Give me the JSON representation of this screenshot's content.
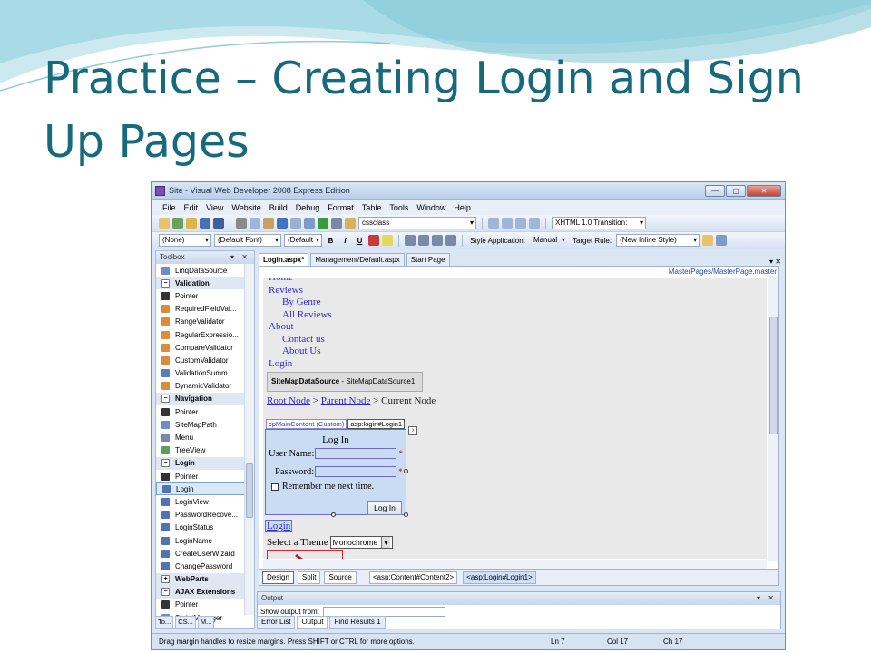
{
  "slide": {
    "title": "Practice – Creating Login and Sign Up Pages"
  },
  "window": {
    "title": "Site - Visual Web Developer 2008 Express Edition",
    "buttons": {
      "minimize": "—",
      "maximize": "▢",
      "close": "✕"
    }
  },
  "menu": [
    "File",
    "Edit",
    "View",
    "Website",
    "Build",
    "Debug",
    "Format",
    "Table",
    "Tools",
    "Window",
    "Help"
  ],
  "toolbar1": {
    "css_combo": "cssclass",
    "doctype_combo": "XHTML 1.0 Transition:"
  },
  "toolbar2": {
    "block_format": "(None)",
    "font": "(Default Font)",
    "size": "(Default",
    "bold": "B",
    "italic": "I",
    "underline": "U",
    "style_application_label": "Style Application:",
    "style_application_value": "Manual",
    "target_rule_label": "Target Rule:",
    "target_rule_value": "(New Inline Style)"
  },
  "toolbox": {
    "title": "Toolbox",
    "controls": "▾ ✕",
    "items": [
      {
        "label": "LinqDataSource",
        "kind": "item",
        "icon": "datasource-icon"
      },
      {
        "label": "Validation",
        "kind": "cat",
        "icon": "collapse-icon"
      },
      {
        "label": "Pointer",
        "kind": "item",
        "icon": "pointer-icon"
      },
      {
        "label": "RequiredFieldVal...",
        "kind": "item",
        "icon": "validator-icon"
      },
      {
        "label": "RangeValidator",
        "kind": "item",
        "icon": "validator-icon"
      },
      {
        "label": "RegularExpressio...",
        "kind": "item",
        "icon": "validator-icon"
      },
      {
        "label": "CompareValidator",
        "kind": "item",
        "icon": "validator-icon"
      },
      {
        "label": "CustomValidator",
        "kind": "item",
        "icon": "validator-icon"
      },
      {
        "label": "ValidationSumm...",
        "kind": "item",
        "icon": "summary-icon"
      },
      {
        "label": "DynamicValidator",
        "kind": "item",
        "icon": "validator-icon"
      },
      {
        "label": "Navigation",
        "kind": "cat",
        "icon": "collapse-icon"
      },
      {
        "label": "Pointer",
        "kind": "item",
        "icon": "pointer-icon"
      },
      {
        "label": "SiteMapPath",
        "kind": "item",
        "icon": "sitemap-icon"
      },
      {
        "label": "Menu",
        "kind": "item",
        "icon": "menu-icon"
      },
      {
        "label": "TreeView",
        "kind": "item",
        "icon": "treeview-icon"
      },
      {
        "label": "Login",
        "kind": "cat",
        "icon": "collapse-icon"
      },
      {
        "label": "Pointer",
        "kind": "item",
        "icon": "pointer-icon"
      },
      {
        "label": "Login",
        "kind": "sel",
        "icon": "login-icon"
      },
      {
        "label": "LoginView",
        "kind": "item",
        "icon": "loginview-icon"
      },
      {
        "label": "PasswordRecove...",
        "kind": "item",
        "icon": "password-icon"
      },
      {
        "label": "LoginStatus",
        "kind": "item",
        "icon": "loginstatus-icon"
      },
      {
        "label": "LoginName",
        "kind": "item",
        "icon": "loginname-icon"
      },
      {
        "label": "CreateUserWizard",
        "kind": "item",
        "icon": "wizard-icon"
      },
      {
        "label": "ChangePassword",
        "kind": "item",
        "icon": "password-icon"
      },
      {
        "label": "WebParts",
        "kind": "cat",
        "icon": "expand-icon"
      },
      {
        "label": "AJAX Extensions",
        "kind": "cat",
        "icon": "collapse-icon"
      },
      {
        "label": "Pointer",
        "kind": "item",
        "icon": "pointer-icon"
      },
      {
        "label": "ScriptManager",
        "kind": "item",
        "icon": "script-icon"
      }
    ],
    "bottom_tabs": [
      "To...",
      "CS...",
      "M..."
    ]
  },
  "doc_tabs": [
    "Login.aspx*",
    "Management/Default.aspx",
    "Start Page"
  ],
  "doc_tab_controls": "▾ ✕",
  "design": {
    "master_path": "MasterPages/MasterPage.master",
    "nav": [
      {
        "label": "Home",
        "sub": false
      },
      {
        "label": "Reviews",
        "sub": false
      },
      {
        "label": "By Genre",
        "sub": true
      },
      {
        "label": "All Reviews",
        "sub": true
      },
      {
        "label": "About",
        "sub": false
      },
      {
        "label": "Contact us",
        "sub": true
      },
      {
        "label": "About Us",
        "sub": true
      },
      {
        "label": "Login",
        "sub": false
      }
    ],
    "sitemap_datasource_type": "SiteMapDataSource",
    "sitemap_datasource_id": " - SiteMapDataSource1",
    "breadcrumb": {
      "root": "Root Node",
      "sep": " > ",
      "parent": "Parent Node",
      "current": "Current Node"
    },
    "content_tag": "cpMainContent (Custom)",
    "login_tag": "asp:login#Login1",
    "login": {
      "title": "Log In",
      "username_label": "User Name:",
      "password_label": "Password:",
      "required_marker": "*",
      "remember_label": "Remember me next time.",
      "button_label": "Log In"
    },
    "login_link": "Login",
    "theme_label": "Select a Theme",
    "theme_value": "Monochrome"
  },
  "view_bar": {
    "design": "Design",
    "split": "Split",
    "source": "Source",
    "tag_paths": [
      "<asp:Content#Content2>",
      "<asp:Login#Login1>"
    ]
  },
  "output": {
    "title": "Output",
    "controls": "▾ ✕",
    "show_from": "Show output from:",
    "tabs": [
      "Error List",
      "Output",
      "Find Results 1"
    ]
  },
  "status": {
    "message": "Drag margin handles to resize margins. Press SHIFT or CTRL for more options.",
    "ln": "Ln 7",
    "col": "Col 17",
    "ch": "Ch 17"
  },
  "colors": {
    "title": "#17697c",
    "accent": "#2a2ae0"
  }
}
